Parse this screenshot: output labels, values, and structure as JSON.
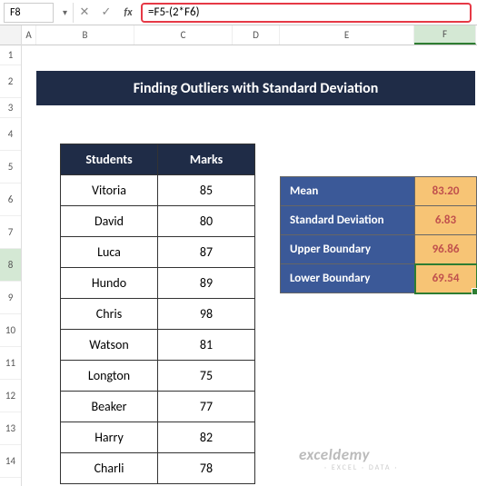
{
  "nameBox": "F8",
  "formula": "=F5-(2*F6)",
  "columns": [
    "A",
    "B",
    "C",
    "D",
    "E",
    "F"
  ],
  "rows": [
    "1",
    "2",
    "3",
    "4",
    "5",
    "6",
    "7",
    "8",
    "9",
    "10",
    "11",
    "12",
    "13",
    "14"
  ],
  "title": "Finding Outliers with Standard Deviation",
  "table": {
    "headers": [
      "Students",
      "Marks"
    ],
    "data": [
      [
        "Vitoria",
        "85"
      ],
      [
        "David",
        "80"
      ],
      [
        "Luca",
        "87"
      ],
      [
        "Hundo",
        "89"
      ],
      [
        "Chris",
        "98"
      ],
      [
        "Watson",
        "81"
      ],
      [
        "Longton",
        "75"
      ],
      [
        "Beaker",
        "77"
      ],
      [
        "Harry",
        "82"
      ],
      [
        "Charli",
        "78"
      ]
    ]
  },
  "stats": [
    {
      "label": "Mean",
      "value": "83.20"
    },
    {
      "label": "Standard Deviation",
      "value": "6.83"
    },
    {
      "label": "Upper Boundary",
      "value": "96.86"
    },
    {
      "label": "Lower Boundary",
      "value": "69.54"
    }
  ],
  "watermark": "exceldemy",
  "watermarkSub": "· EXCEL · DATA ·",
  "chart_data": {
    "type": "table",
    "title": "Finding Outliers with Standard Deviation",
    "columns": [
      "Students",
      "Marks"
    ],
    "rows": [
      [
        "Vitoria",
        85
      ],
      [
        "David",
        80
      ],
      [
        "Luca",
        87
      ],
      [
        "Hundo",
        89
      ],
      [
        "Chris",
        98
      ],
      [
        "Watson",
        81
      ],
      [
        "Longton",
        75
      ],
      [
        "Beaker",
        77
      ],
      [
        "Harry",
        82
      ],
      [
        "Charli",
        78
      ]
    ],
    "stats": {
      "Mean": 83.2,
      "Standard Deviation": 6.83,
      "Upper Boundary": 96.86,
      "Lower Boundary": 69.54
    }
  }
}
